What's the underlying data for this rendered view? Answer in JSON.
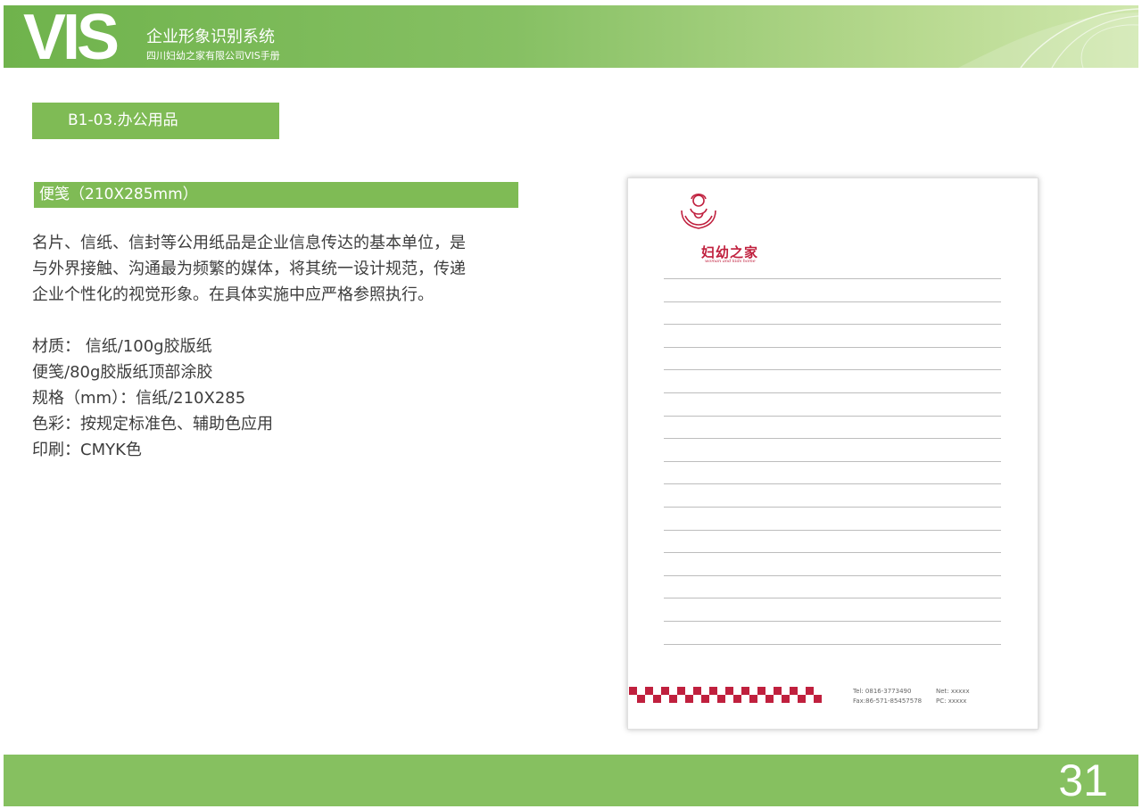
{
  "header": {
    "logo_text": "VIS",
    "title": "企业形象识别系统",
    "subtitle": "四川妇幼之家有限公司VIS手册"
  },
  "section": {
    "label": "B1-03.办公用品"
  },
  "item": {
    "label": "便笺（210X285mm）"
  },
  "description": [
    "名片、信纸、信封等公用纸品是企业信息传达的基本单位，是",
    "与外界接触、沟通最为频繁的媒体，将其统一设计规范，传递",
    "企业个性化的视觉形象。在具体实施中应严格参照执行。"
  ],
  "specs": [
    "材质：  信纸/100g胶版纸",
    "便笺/80g胶版纸顶部涂胶",
    "规格（mm）：信纸/210X285",
    "色彩：按规定标准色、辅助色应用",
    "印刷：CMYK色"
  ],
  "paper": {
    "brand_name": "妇幼之家",
    "brand_slogan": "woman and kids home",
    "line_count": 17,
    "contact_left": [
      "Tel: 0816-3773490",
      "Fax:86-571-85457578"
    ],
    "contact_right": [
      "Net: xxxxx",
      "PC: xxxxx"
    ]
  },
  "footer": {
    "page_number": "31"
  },
  "colors": {
    "brand_green": "#7fbb55",
    "accent_red": "#c0203e",
    "text": "#3d3d3d"
  },
  "icons": [
    "brand-logo-icon",
    "checker-pattern-icon"
  ]
}
